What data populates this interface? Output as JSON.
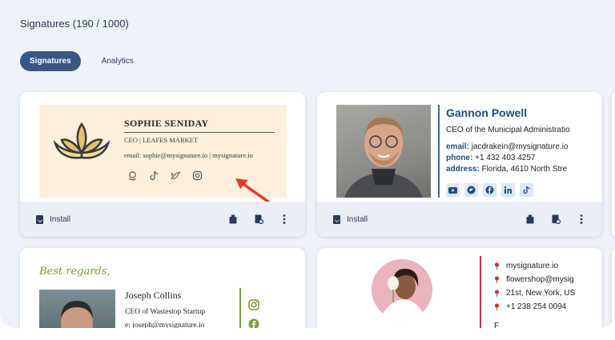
{
  "page": {
    "title": "Signatures (190 / 1000)"
  },
  "tabs": [
    {
      "label": "Signatures",
      "active": true
    },
    {
      "label": "Analytics",
      "active": false
    }
  ],
  "cards": {
    "sophie": {
      "name": "SOPHIE SENIDAY",
      "role": "CEO | LEAFES MARKET",
      "contact": "email: sophie@mysignature.io | mysignature.io",
      "socials": [
        "amazon-icon",
        "tiktok-icon",
        "twitter-icon",
        "instagram-icon"
      ],
      "bg_color": "#fcefdb"
    },
    "gannon": {
      "name": "Gannon Powell",
      "role": "CEO of the Municipal Administratio",
      "email_label": "email:",
      "email": "jacdrakein@mysignature.io",
      "phone_label": "phone:",
      "phone": "+1 432 403 4257",
      "address_label": "address:",
      "address": "Florida, 4610 North Stre",
      "socials": [
        "youtube-icon",
        "twitter-icon",
        "facebook-icon",
        "linkedin-icon",
        "tiktok-icon"
      ],
      "accent": "#1e4d80"
    },
    "joseph": {
      "greeting": "Best regards,",
      "name": "Joseph Collins",
      "role": "CEO of Wastestop Startup",
      "email": "e: joseph@mysignature.io",
      "accent": "#7a9d3a"
    },
    "flower": {
      "lines": [
        "mysignature.io",
        "flowershop@mysig",
        "21st, New York, US",
        "+1 238 254 0094"
      ],
      "partial": "F",
      "accent": "#c8334a"
    }
  },
  "footer": {
    "install_label": "Install"
  }
}
